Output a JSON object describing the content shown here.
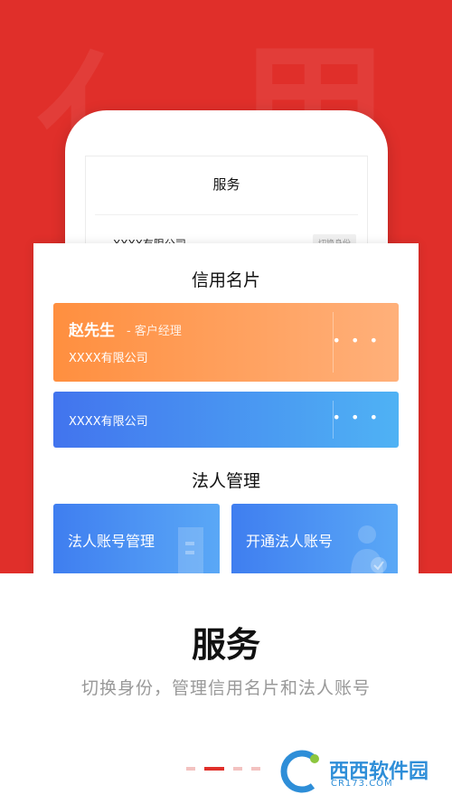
{
  "hero": {
    "phone": {
      "title": "服务",
      "company": "XXXX有限公司",
      "switch_label": "切换身份"
    }
  },
  "credit_card_section": {
    "title": "信用名片",
    "cards": [
      {
        "name": "赵先生",
        "role": "- 客户经理",
        "company": "XXXX有限公司",
        "more": "• • •"
      },
      {
        "company": "XXXX有限公司",
        "more": "• • •"
      }
    ]
  },
  "legal_section": {
    "title": "法人管理",
    "tiles": [
      {
        "label": "法人账号管理"
      },
      {
        "label": "开通法人账号"
      }
    ]
  },
  "footer": {
    "title": "服务",
    "subtitle": "切换身份，管理信用名片和法人账号"
  },
  "pagination": {
    "total": 4,
    "active_index": 1
  },
  "watermark": {
    "text": "西西软件园",
    "url": "CR173.COM"
  },
  "colors": {
    "brand_red": "#e02f2a",
    "orange": "#ff8f3f",
    "blue": "#4274ee",
    "watermark_blue": "#2e8ed8"
  }
}
